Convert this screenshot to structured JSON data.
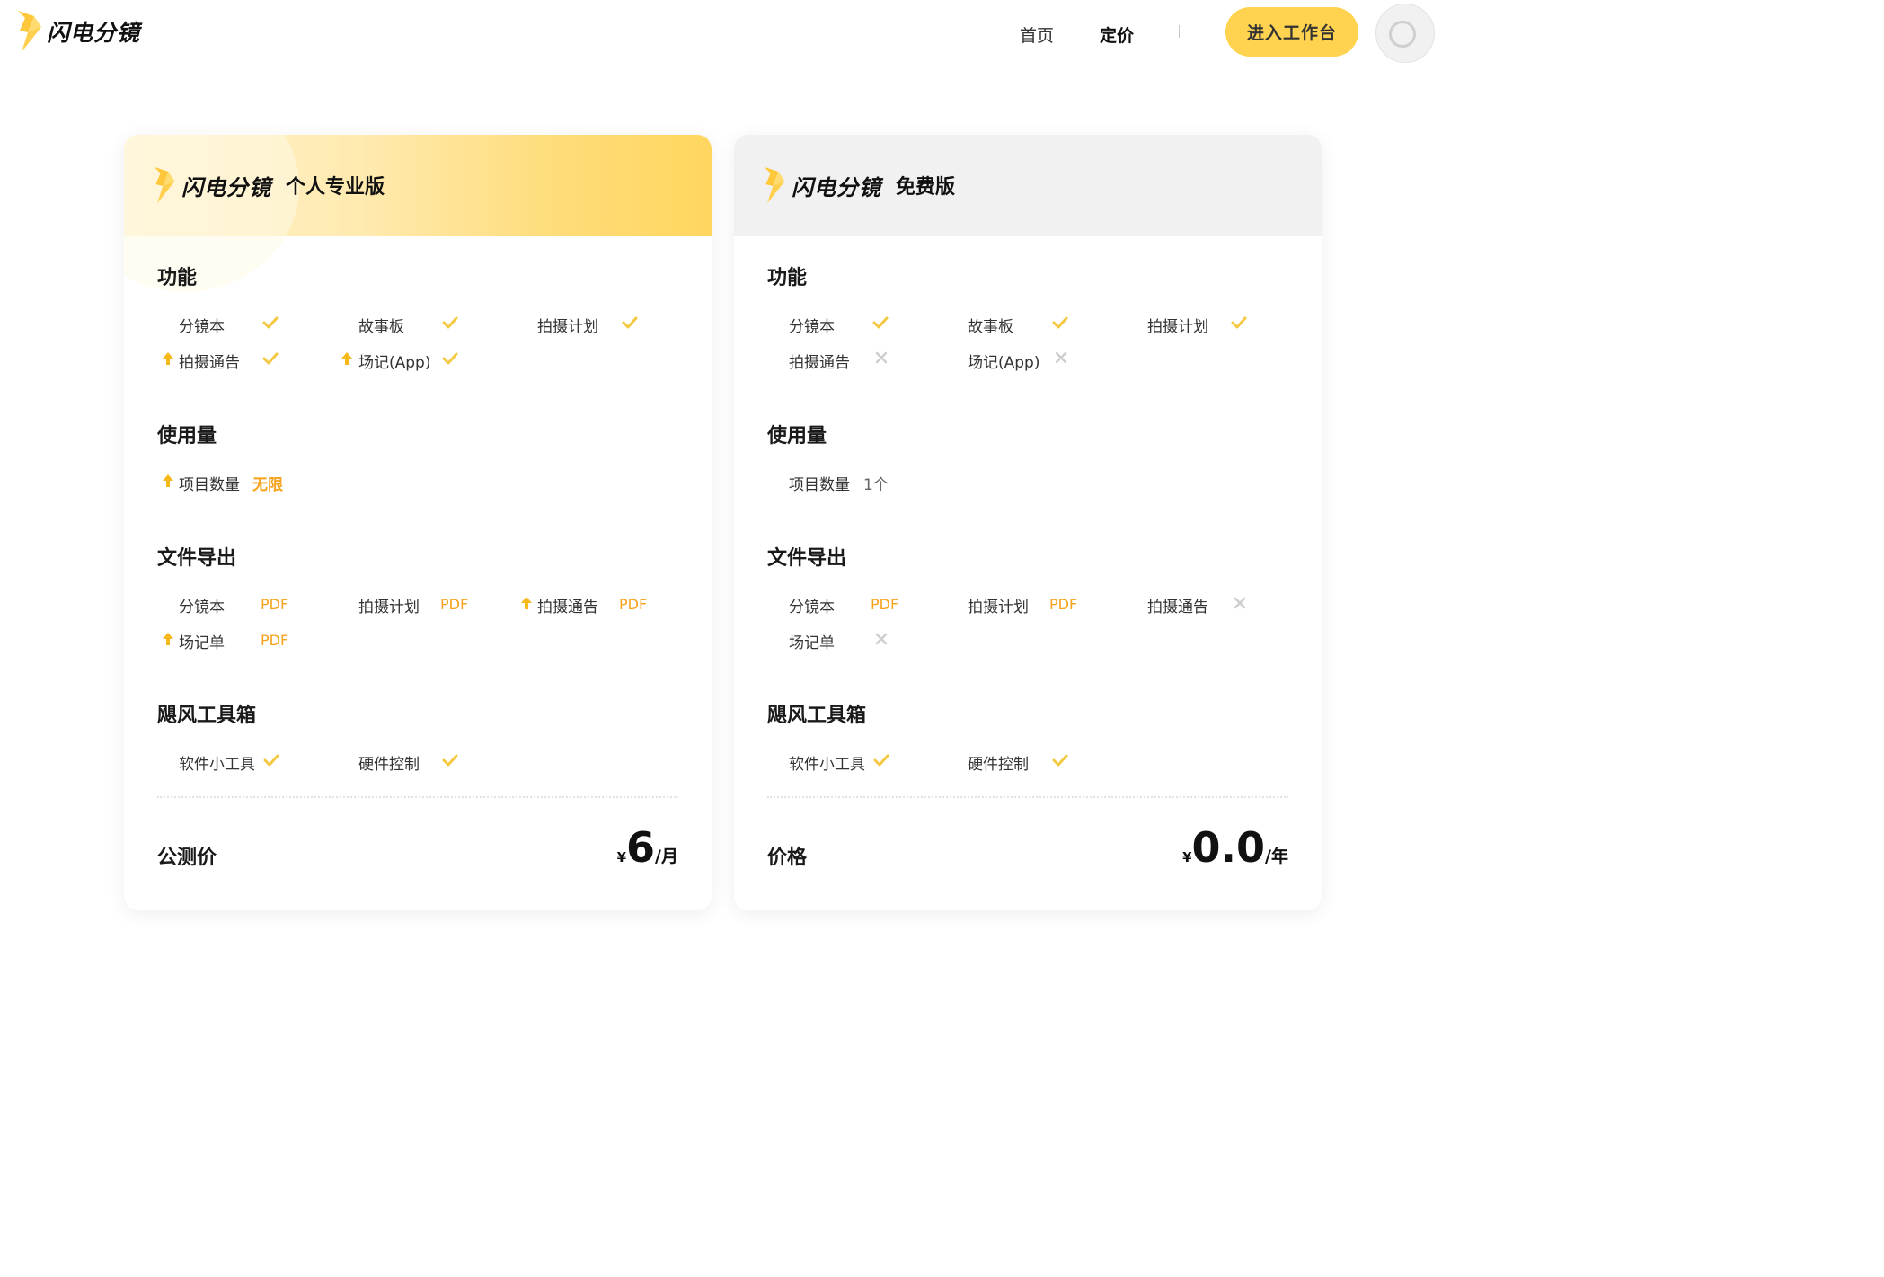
{
  "header": {
    "brand": "闪电分镜",
    "nav": {
      "home": "首页",
      "pricing": "定价",
      "divider": "|"
    },
    "cta": "进入工作台"
  },
  "colors": {
    "accent": "#ffd34f",
    "check": "#f5c842",
    "orange": "#f7a21b",
    "cross": "#cfcfcf"
  },
  "plans": {
    "pro": {
      "brand": "闪电分镜",
      "edition": "个人专业版",
      "features_title": "功能",
      "features": [
        {
          "label": "分镜本",
          "status": "check"
        },
        {
          "label": "故事板",
          "status": "check"
        },
        {
          "label": "拍摄计划",
          "status": "check"
        },
        {
          "label": "拍摄通告",
          "status": "check",
          "upgrade": true
        },
        {
          "label": "场记(App)",
          "status": "check",
          "upgrade": true
        }
      ],
      "usage_title": "使用量",
      "usage": {
        "label": "项目数量",
        "value": "无限",
        "upgrade": true
      },
      "export_title": "文件导出",
      "exports": [
        {
          "label": "分镜本",
          "value": "PDF"
        },
        {
          "label": "拍摄计划",
          "value": "PDF"
        },
        {
          "label": "拍摄通告",
          "value": "PDF",
          "upgrade": true
        },
        {
          "label": "场记单",
          "value": "PDF",
          "upgrade": true
        }
      ],
      "tools_title": "飓风工具箱",
      "tools": [
        {
          "label": "软件小工具",
          "status": "check"
        },
        {
          "label": "硬件控制",
          "status": "check"
        }
      ],
      "price_label": "公测价",
      "price": {
        "currency": "¥",
        "amount": "6",
        "unit": "/月"
      }
    },
    "free": {
      "brand": "闪电分镜",
      "edition": "免费版",
      "features_title": "功能",
      "features": [
        {
          "label": "分镜本",
          "status": "check"
        },
        {
          "label": "故事板",
          "status": "check"
        },
        {
          "label": "拍摄计划",
          "status": "check"
        },
        {
          "label": "拍摄通告",
          "status": "cross"
        },
        {
          "label": "场记(App)",
          "status": "cross"
        }
      ],
      "usage_title": "使用量",
      "usage": {
        "label": "项目数量",
        "value": "1个"
      },
      "export_title": "文件导出",
      "exports": [
        {
          "label": "分镜本",
          "value": "PDF"
        },
        {
          "label": "拍摄计划",
          "value": "PDF"
        },
        {
          "label": "拍摄通告",
          "value": "cross"
        },
        {
          "label": "场记单",
          "value": "cross"
        }
      ],
      "tools_title": "飓风工具箱",
      "tools": [
        {
          "label": "软件小工具",
          "status": "check"
        },
        {
          "label": "硬件控制",
          "status": "check"
        }
      ],
      "price_label": "价格",
      "price": {
        "currency": "¥",
        "amount": "0.0",
        "unit": "/年"
      }
    }
  }
}
